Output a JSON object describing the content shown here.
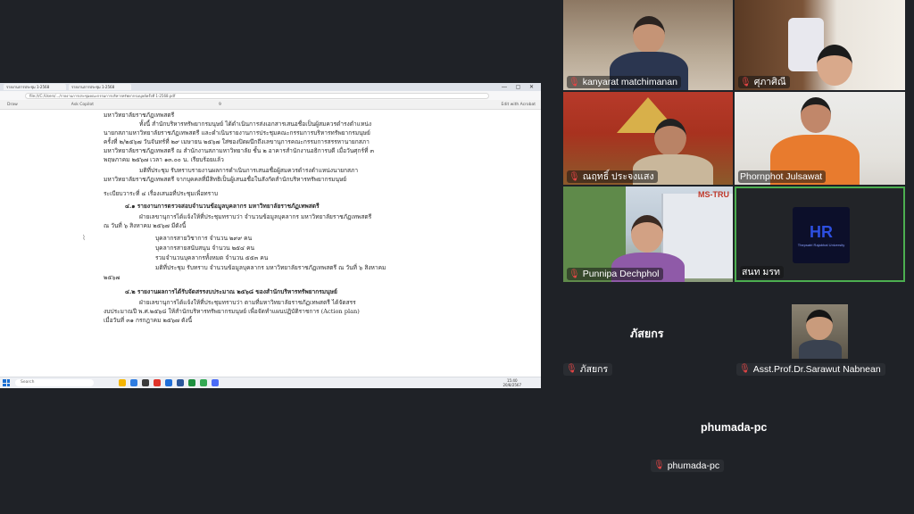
{
  "shared_screen": {
    "browser_tabs": [
      "รายงานการประชุม 1-2568",
      "รายงานการประชุม 1-2568"
    ],
    "address": "file:///C:/Users/.../รายงานการประชุมคณะกรรมการบริหารทรัพยากรมนุษย์ครั้งที่ 1-2568.pdf",
    "pdf_toolbar": {
      "draw": "Draw",
      "ask_copilot": "Ask Copilot",
      "page": "9",
      "edit": "Edit with Acrobat"
    },
    "document_lines": [
      "มหาวิทยาลัยราชภัฏเทพสตรี",
      "ทั้งนี้ สำนักบริหารทรัพยากรมนุษย์ ได้ดำเนินการส่งเอกสารเสนอชื่อเป็นผู้สมควรดำรงตำแหน่ง",
      "นายกสภามหาวิทยาลัยราชภัฏเทพสตรี และดำเนินรายงานการประชุมคณะกรรมการบริหารทรัพยากรมนุษย์",
      "ครั้งที่ ๒/๒๕๖๗ วันจันทร์ที่ ๒๙ เมษายน ๒๕๖๗ ใส่ซองปิดผนึกถึงเลขานุการคณะกรรมการสรรหานายกสภา",
      "มหาวิทยาลัยราชภัฏเทพสตรี ณ สำนักงานสภามหาวิทยาลัย ชั้น ๒ อาคารสำนักงานอธิการบดี เมื่อวันศุกร์ที่ ๓",
      "พฤษภาคม ๒๕๖๗ เวลา ๑๓.๐๐ น. เรียบร้อยแล้ว",
      "มติที่ประชุม รับทราบรายงานผลการดำเนินการเสนอชื่อผู้สมควรดำรงตำแหน่งนายกสภา",
      "มหาวิทยาลัยราชภัฏเทพสตรี จากบุคคลที่มีสิทธิเป็นผู้เสนอชื่อในสังกัดสำนักบริหารทรัพยากรมนุษย์",
      "ระเบียบวาระที่ ๔ เรื่องเสนอที่ประชุมเพื่อทราบ",
      "๔.๑ รายงานการตรวจสอบจำนวนข้อมูลบุคลากร มหาวิทยาลัยราชภัฏเทพสตรี",
      "ฝ่ายเลขานุการได้แจ้งให้ที่ประชุมทราบว่า จำนวนข้อมูลบุคลากร มหาวิทยาลัยราชภัฏเทพสตรี",
      "ณ วันที่ ๖ สิงหาคม ๒๕๖๗ มีดังนี้",
      "บุคลากรสายวิชาการ  จำนวน  ๒๙๙ คน",
      "บุคลากรสายสนับสนุน  จำนวน  ๒๕๔ คน",
      "รวมจำนวนบุคลากรทั้งหมด  จำนวน  ๕๕๓ คน",
      "มติที่ประชุม รับทราบ จำนวนข้อมูลบุคลากร มหาวิทยาลัยราชภัฏเทพสตรี ณ วันที่ ๖ สิงหาคม",
      "๒๕๖๗",
      "๔.๒ รายงานผลการได้รับจัดสรรงบประมาณ ๒๕๖๘ ของสำนักบริหารทรัพยากรมนุษย์",
      "ฝ่ายเลขานุการได้แจ้งให้ที่ประชุมทราบว่า ตามที่มหาวิทยาลัยราชภัฏเทพสตรี ได้จัดสรร",
      "งบประมาณปี พ.ศ.๒๕๖๘ ให้สำนักบริหารทรัพยากรมนุษย์ เพื่อจัดทำแผนปฏิบัติราชการ (Action plan)",
      "เมื่อวันที่ ๓๑ กรกฎาคม ๒๕๖๗ ดังนี้"
    ],
    "taskbar": {
      "search": "Search",
      "time": "15:40",
      "date": "20/8/2567"
    }
  },
  "participants": [
    {
      "name": "kanyarat matchimanan",
      "muted": true
    },
    {
      "name": "ศุภาศิณี",
      "muted": true
    },
    {
      "name": "ณฤทธิ์ ประจงแสง",
      "muted": true
    },
    {
      "name": "Phornphot Julsawat",
      "muted": false
    },
    {
      "name": "Punnipa Dechphol",
      "muted": true,
      "banner": "MS-TRU"
    },
    {
      "name": "สนท มรท",
      "muted": false,
      "logo_text": "HR",
      "logo_sub": "Thepsatri Rajabhat University"
    },
    {
      "name": "ภัสยกร",
      "muted": true
    },
    {
      "name": "Asst.Prof.Dr.Sarawut Nabnean",
      "muted": true
    },
    {
      "name": "phumada-pc",
      "muted": true
    }
  ],
  "icons": {
    "muted_mic": "mic-off-icon"
  },
  "colors": {
    "background": "#1f2227",
    "muted": "#e64545",
    "active_speaker": "#4caf50"
  }
}
